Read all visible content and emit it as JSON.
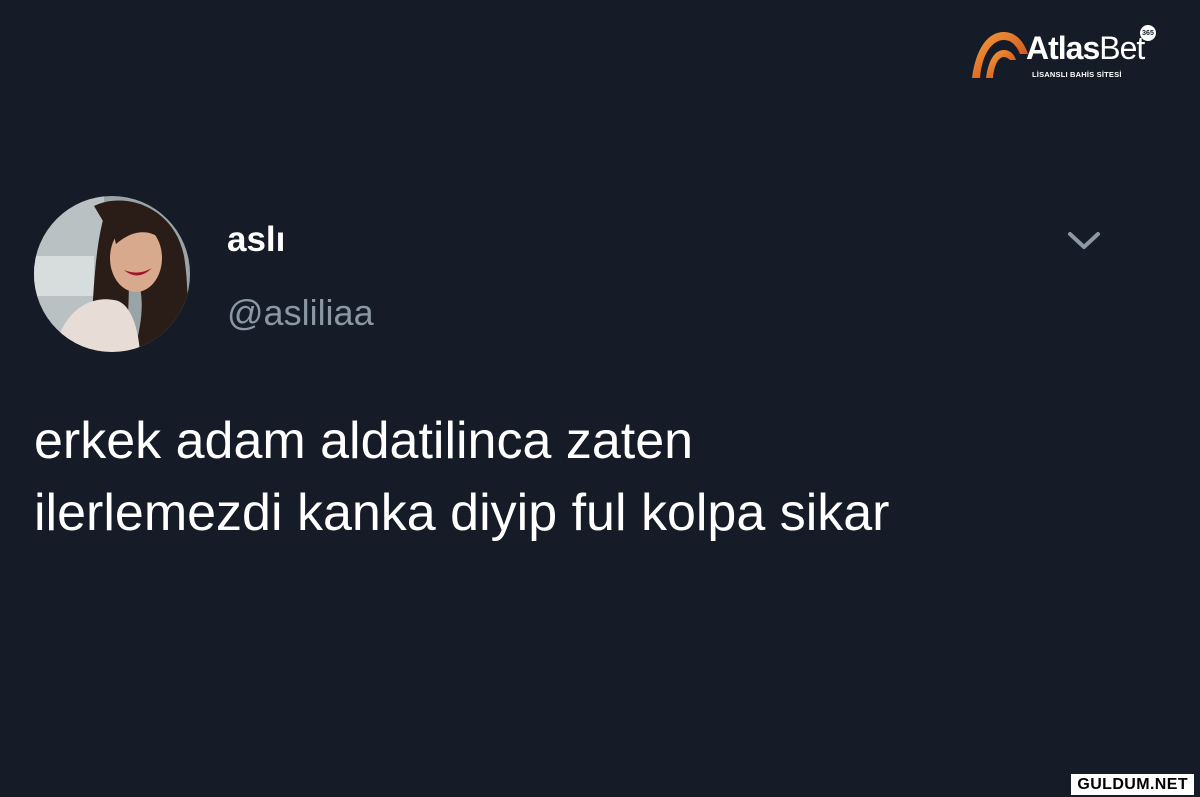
{
  "brand": {
    "name_bold": "Atlas",
    "name_regular": "Bet",
    "tagline": "LİSANSLI BAHİS SİTESİ",
    "badge": "365",
    "accent_color": "#f07a1a",
    "icon": "atlas-arch-logo"
  },
  "tweet": {
    "display_name": "aslı",
    "handle": "@asliliaa",
    "avatar_icon": "profile-photo",
    "menu_icon": "chevron-down-icon",
    "text_lines": [
      "erkek adam aldatilinca zaten",
      "ilerlemezdi kanka diyip ful kolpa sikar"
    ]
  },
  "watermark": {
    "text": "GULDUM.NET"
  },
  "colors": {
    "background": "#151c27",
    "text": "#ffffff",
    "secondary_text": "#8a97a4"
  }
}
